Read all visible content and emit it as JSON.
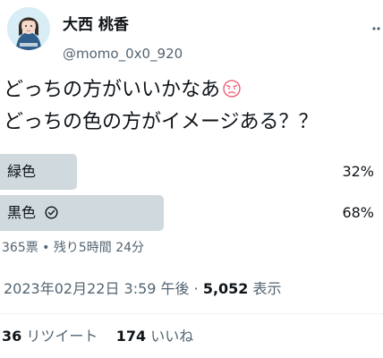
{
  "author": {
    "display_name": "大西 桃香",
    "handle": "@momo_0x0_920",
    "avatar_icon": "person-avatar-icon"
  },
  "tweet": {
    "line1": "どっちの方がいいかなあ",
    "line2": "どっちの色の方がイメージある？？",
    "emoji_icon": "pouting-face-emoji-icon"
  },
  "poll": {
    "options": [
      {
        "label": "緑色",
        "percent": "32%",
        "fraction": 0.32,
        "winner": false
      },
      {
        "label": "黒色",
        "percent": "68%",
        "fraction": 0.68,
        "winner": true,
        "check_icon": "check-circle-icon"
      }
    ],
    "bar_color_loser": "#cfd9de",
    "bar_color_winner": "#cfd9de",
    "meta": "365票 • 残り5時間 24分"
  },
  "timestamp": {
    "datetime": "2023年02月22日 3:59 午後",
    "separator": " · ",
    "views_count": "5,052",
    "views_label": "表示"
  },
  "stats": {
    "retweets_count": "36",
    "retweets_label": "リツイート",
    "likes_count": "174",
    "likes_label": "いいね"
  }
}
